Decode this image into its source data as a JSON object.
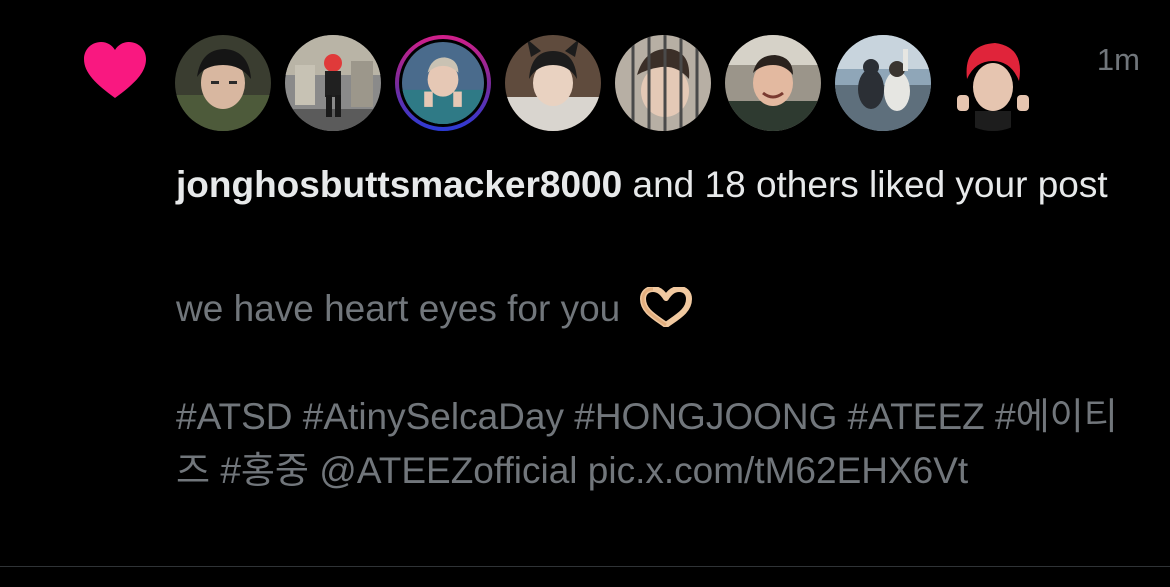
{
  "notification": {
    "type_icon": "heart-icon",
    "accent_color": "#f91880",
    "timestamp": "1m",
    "avatars": [
      {
        "icon": "avatar-photo",
        "alt": "user avatar 1"
      },
      {
        "icon": "avatar-photo",
        "alt": "user avatar 2"
      },
      {
        "icon": "avatar-photo",
        "alt": "user avatar 3"
      },
      {
        "icon": "avatar-photo",
        "alt": "user avatar 4"
      },
      {
        "icon": "avatar-photo",
        "alt": "user avatar 5"
      },
      {
        "icon": "avatar-photo",
        "alt": "user avatar 6"
      },
      {
        "icon": "avatar-photo",
        "alt": "user avatar 7"
      },
      {
        "icon": "avatar-photo",
        "alt": "user avatar 8"
      }
    ],
    "username": "jonghosbuttsmacker8000",
    "summary_rest": " and 18 others liked your post",
    "post_text": "we have heart eyes for you",
    "post_emoji": "heart-hands-emoji",
    "post_tags": "#ATSD #AtinySelcaDay #HONGJOONG #ATEEZ #에이티즈 #홍중 @ATEEZofficial pic.x.com/tM62EHX6Vt"
  }
}
